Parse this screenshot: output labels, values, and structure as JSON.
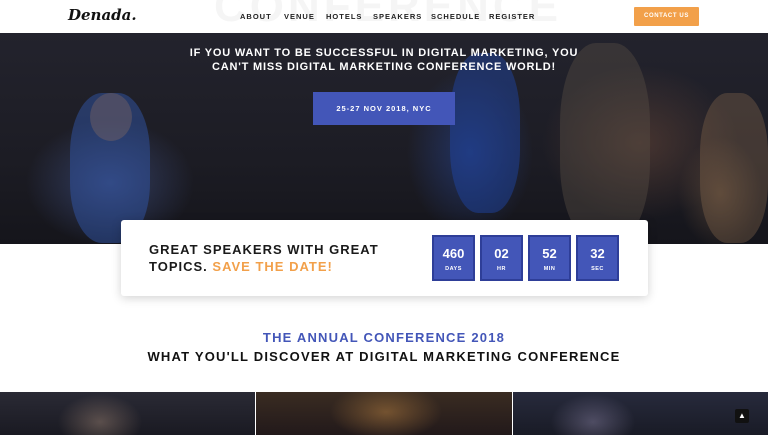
{
  "header": {
    "logo": "Denada.",
    "ghost_title": "CONFERENCE",
    "nav": [
      "ABOUT",
      "VENUE",
      "HOTELS",
      "SPEAKERS",
      "SCHEDULE",
      "REGISTER"
    ],
    "contact_label": "CONTACT US"
  },
  "hero": {
    "line1": "IF YOU WANT TO BE SUCCESSFUL IN DIGITAL MARKETING, YOU",
    "line2": "CAN'T MISS DIGITAL MARKETING CONFERENCE WORLD!",
    "date_button": "25-27 NOV 2018, NYC"
  },
  "countdown": {
    "headline_part1": "GREAT SPEAKERS WITH GREAT TOPICS.",
    "headline_accent": "SAVE THE DATE!",
    "units": [
      {
        "value": "460",
        "label": "DAYS"
      },
      {
        "value": "02",
        "label": "HR"
      },
      {
        "value": "52",
        "label": "MIN"
      },
      {
        "value": "32",
        "label": "SEC"
      }
    ]
  },
  "section": {
    "subtitle": "THE ANNUAL CONFERENCE 2018",
    "title": "WHAT YOU'LL DISCOVER AT DIGITAL MARKETING CONFERENCE"
  },
  "colors": {
    "accent_orange": "#f2a04a",
    "brand_blue": "#4356b8"
  },
  "icons": {
    "scroll_top": "chevron-up-icon"
  }
}
